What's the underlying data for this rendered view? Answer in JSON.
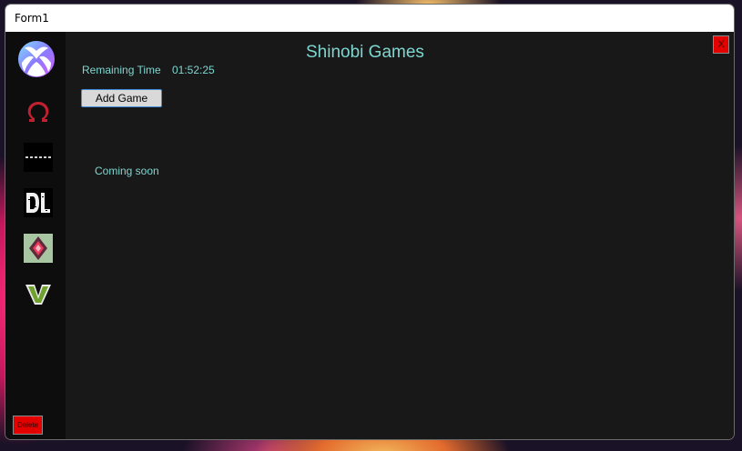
{
  "window": {
    "title": "Form1"
  },
  "header": {
    "title": "Shinobi Games",
    "close_label": "X"
  },
  "timer": {
    "label": "Remaining Time",
    "value": "01:52:25"
  },
  "buttons": {
    "add_game": "Add Game",
    "delete": "Delete"
  },
  "status": {
    "coming_soon": "Coming soon"
  },
  "sidebar": {
    "items": [
      {
        "icon": "xbox-logo-icon"
      },
      {
        "icon": "god-of-war-omega-icon"
      },
      {
        "icon": "sekiro-logo-icon"
      },
      {
        "icon": "dying-light-logo-icon"
      },
      {
        "icon": "no-mans-sky-icon"
      },
      {
        "icon": "gta-v-logo-icon"
      }
    ]
  },
  "colors": {
    "accent_text": "#7fd6d0",
    "panel": "#181818",
    "sidebar": "#0d0d0d",
    "danger": "#e50000"
  }
}
